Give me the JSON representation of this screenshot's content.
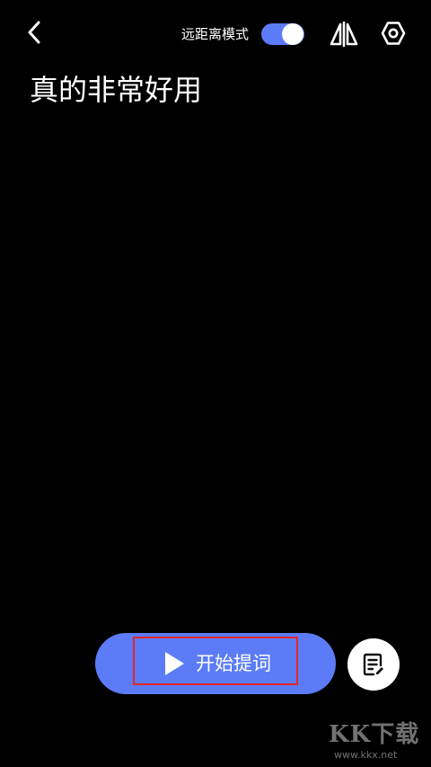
{
  "header": {
    "back_icon": "chevron-left-icon",
    "long_distance_mode": {
      "label": "远距离模式",
      "enabled": true,
      "toggle_color": "#5b7cf6"
    },
    "mirror_icon": "mirror-flip-icon",
    "settings_icon": "hexagon-gear-icon"
  },
  "script": {
    "text": "真的非常好用"
  },
  "controls": {
    "start_label": "开始提词",
    "start_icon": "play-icon",
    "start_color": "#5b7cf6",
    "highlight_color": "#e5252a",
    "script_list_icon": "document-edit-icon"
  },
  "watermark": {
    "brand": "KK下载",
    "url": "www.kkx.net"
  }
}
